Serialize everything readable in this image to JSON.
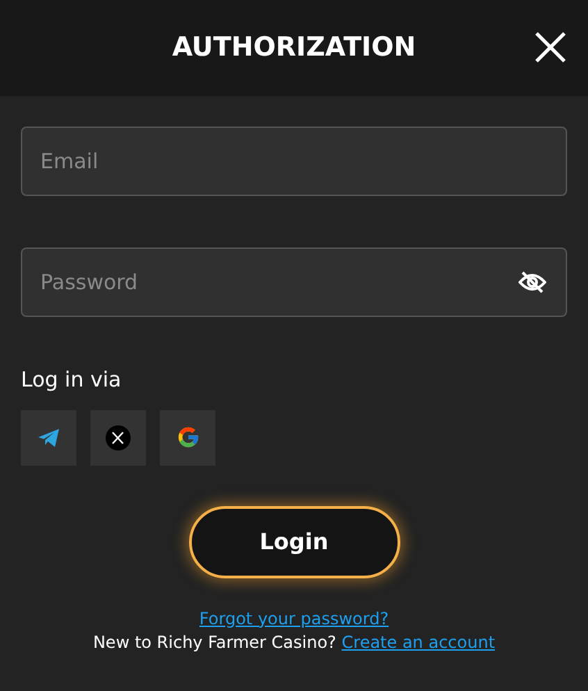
{
  "header": {
    "title": "AUTHORIZATION"
  },
  "fields": [
    {
      "placeholder": "Email",
      "kind": "text"
    },
    {
      "placeholder": "Password",
      "kind": "password"
    }
  ],
  "social": {
    "label": "Log in via",
    "buttons": [
      {
        "kind": "telegram"
      },
      {
        "kind": "x"
      },
      {
        "kind": "google"
      }
    ]
  },
  "login_button": "Login",
  "forgot_link": "Forgot your password?",
  "signup": {
    "text": "New to Richy Farmer Casino?",
    "link": "Create an account"
  }
}
